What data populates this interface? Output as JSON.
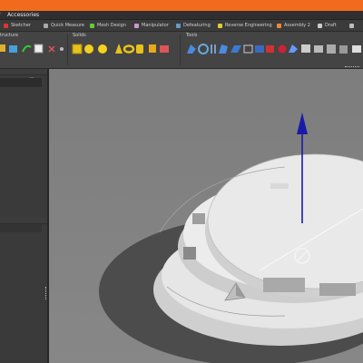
{
  "app": {
    "menu_title": "Accessories",
    "tabs": [
      {
        "label": "Sketcher"
      },
      {
        "label": "Quick Measure"
      },
      {
        "label": "Mesh Design"
      },
      {
        "label": "Manipulator"
      },
      {
        "label": "Defeaturing"
      },
      {
        "label": "Reverse Engineering"
      },
      {
        "label": "Assembly 2"
      },
      {
        "label": "Draft"
      }
    ],
    "ribbon_groups": [
      {
        "label": "tructure"
      },
      {
        "label": "Solids"
      },
      {
        "label": "Tools"
      }
    ]
  },
  "colors": {
    "brand": "#f26b1d",
    "axis_arrow": "#1a1aa8"
  }
}
